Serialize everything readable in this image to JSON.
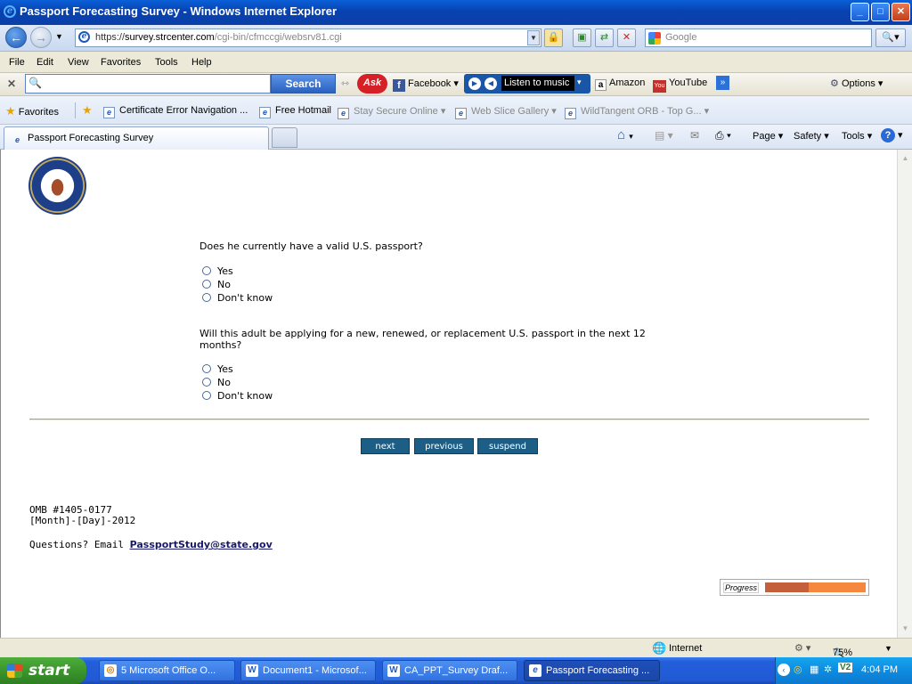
{
  "window": {
    "title": "Passport Forecasting Survey - Windows Internet Explorer",
    "controls": [
      "_",
      "□",
      "✕"
    ]
  },
  "address_bar": {
    "url_scheme": "https://",
    "url_host": "survey.strcenter.com",
    "url_path": "/cgi-bin/cfmccgi/websrv81.cgi",
    "search_placeholder": "Google"
  },
  "menu": [
    "File",
    "Edit",
    "View",
    "Favorites",
    "Tools",
    "Help"
  ],
  "ask_toolbar": {
    "search_button": "Search",
    "ask_logo": "Ask",
    "facebook": "Facebook",
    "music": "Listen to music",
    "amazon": "Amazon",
    "youtube": "YouTube",
    "options": "Options"
  },
  "favorites_bar": {
    "favorites_label": "Favorites",
    "items": [
      "Certificate Error Navigation ...",
      "Free Hotmail",
      "Stay Secure Online",
      "Web Slice Gallery",
      "WildTangent ORB - Top G..."
    ]
  },
  "tabs": {
    "active_tab": "Passport Forecasting Survey"
  },
  "command_bar": [
    "Page",
    "Safety",
    "Tools"
  ],
  "survey": {
    "q1": {
      "text": "Does he currently have a valid U.S. passport?",
      "options": [
        "Yes",
        "No",
        "Don't know"
      ]
    },
    "q2": {
      "text_line1": "Will this adult be applying for a new, renewed, or replacement U.S. passport in the next 12",
      "text_line2": "months?",
      "options": [
        "Yes",
        "No",
        "Don't know"
      ]
    },
    "buttons": {
      "next": "next",
      "previous": "previous",
      "suspend": "suspend"
    },
    "footer": {
      "omb": "OMB #1405-0177",
      "date": "[Month]-[Day]-2012",
      "questions_prefix": "Questions? Email ",
      "email": "PassportStudy@state.gov"
    },
    "progress": {
      "label": "Progress",
      "fraction": 0.43
    }
  },
  "status_bar": {
    "zone": "Internet",
    "zoom": "75%"
  },
  "taskbar": {
    "start": "start",
    "tasks": [
      "5 Microsoft Office O...",
      "Document1 - Microsof...",
      "CA_PPT_Survey Draf...",
      "Passport Forecasting ..."
    ],
    "clock": "4:04 PM"
  },
  "colors": {
    "button_bg": "#1c5e86",
    "progress_done": "#c45f3c",
    "progress_remaining": "#f5873f",
    "email_link": "#19196b"
  }
}
